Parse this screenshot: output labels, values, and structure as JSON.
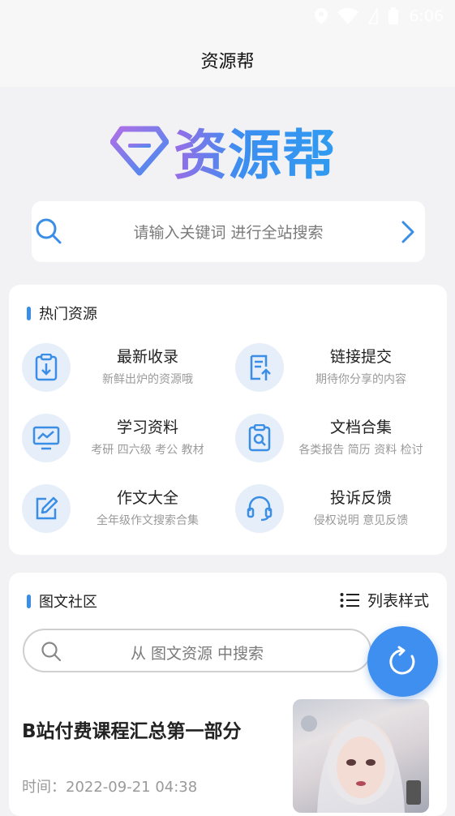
{
  "status_bar": {
    "time": "6:06"
  },
  "app_bar": {
    "title": "资源帮"
  },
  "logo": {
    "text": "资源帮",
    "colors": [
      "#9a6ce6",
      "#3d8ef0"
    ]
  },
  "search": {
    "placeholder": "请输入关键词 进行全站搜索"
  },
  "hot": {
    "title": "热门资源",
    "items": [
      {
        "title": "最新收录",
        "subtitle": "新鲜出炉的资源哦",
        "icon": "clipboard-download-icon"
      },
      {
        "title": "链接提交",
        "subtitle": "期待你分享的内容",
        "icon": "document-upload-icon"
      },
      {
        "title": "学习资料",
        "subtitle": "考研 四六级 考公 教材",
        "icon": "monitor-chart-icon"
      },
      {
        "title": "文档合集",
        "subtitle": "各类报告 简历 资料 检讨",
        "icon": "clipboard-search-icon"
      },
      {
        "title": "作文大全",
        "subtitle": "全年级作文搜索合集",
        "icon": "edit-icon"
      },
      {
        "title": "投诉反馈",
        "subtitle": "侵权说明 意见反馈",
        "icon": "headset-icon"
      }
    ]
  },
  "community": {
    "title": "图文社区",
    "list_style_label": "列表样式",
    "search_placeholder": "从 图文资源 中搜索",
    "posts": [
      {
        "title": "B站付费课程汇总第一部分",
        "time": "时间：2022-09-21 04:38"
      }
    ]
  },
  "accent_color": "#3a8ee6"
}
